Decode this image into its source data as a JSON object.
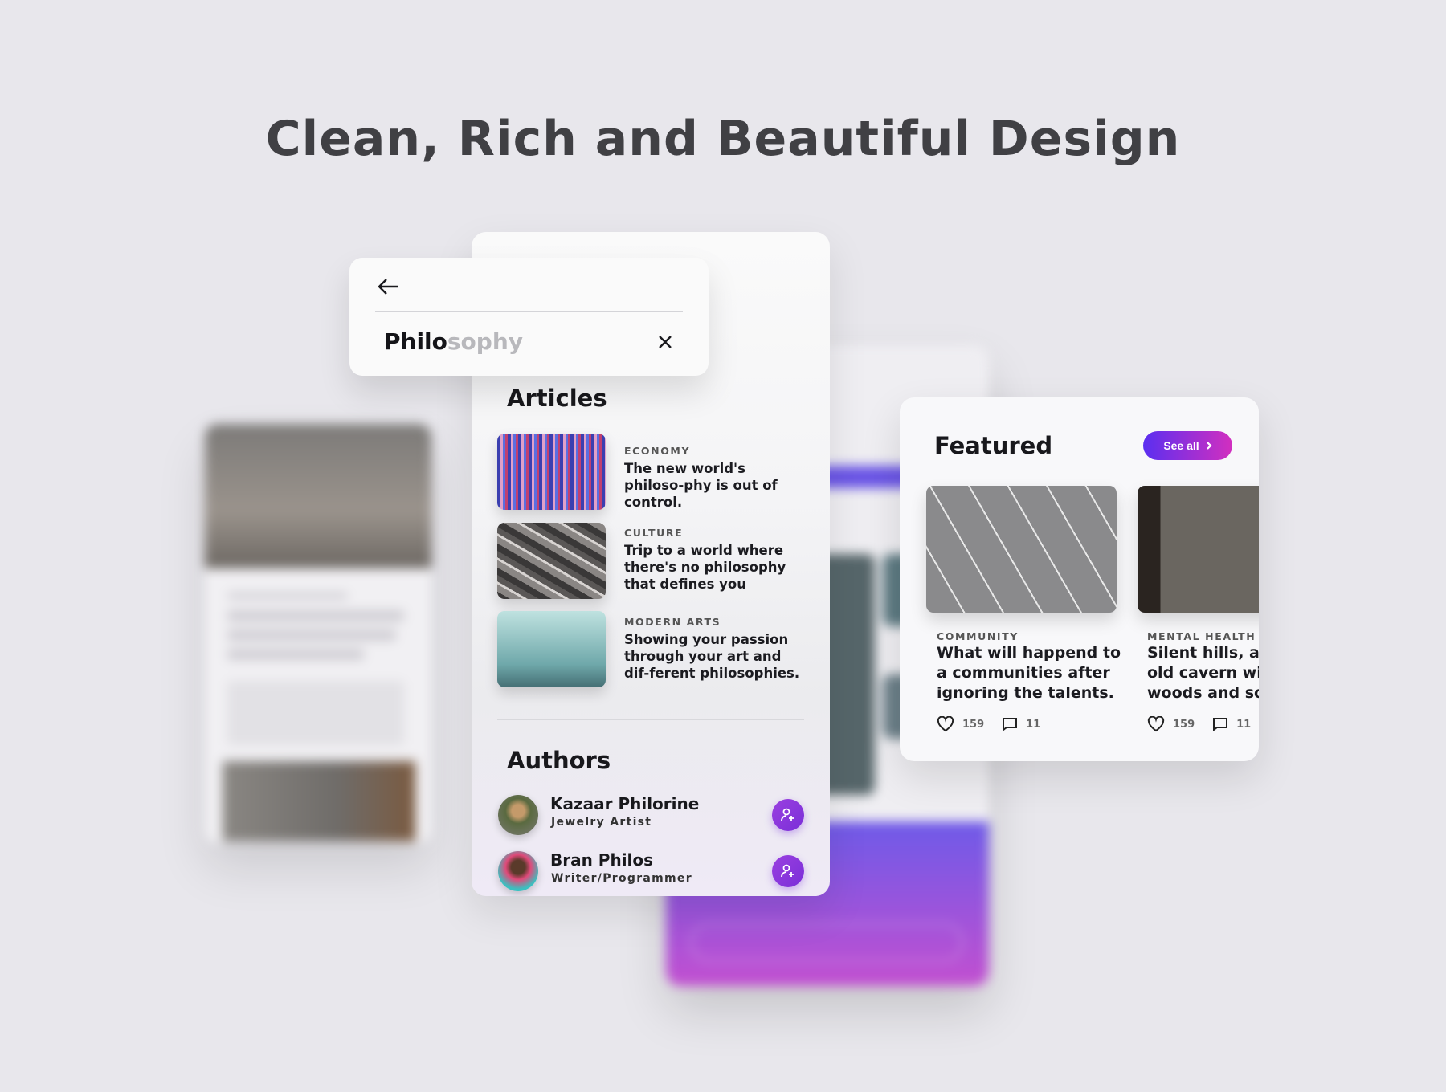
{
  "headline": "Clean, Rich and Beautiful Design",
  "colors": {
    "accent_start": "#5b2ff0",
    "accent_end": "#d22fbf",
    "add_button": "#8a36dc",
    "background": "#e8e7ec"
  },
  "search": {
    "typed": "Philo",
    "suggestion": "sophy",
    "back_icon": "arrow-left-icon",
    "clear_icon": "close-icon"
  },
  "articles": {
    "heading": "Articles",
    "items": [
      {
        "category": "Economy",
        "title": "The new world's philoso-phy is out of control."
      },
      {
        "category": "Culture",
        "title": "Trip to a world where there's no philosophy that defines you"
      },
      {
        "category": "Modern Arts",
        "title": "Showing your passion through your art and dif-ferent philosophies."
      }
    ]
  },
  "authors": {
    "heading": "Authors",
    "items": [
      {
        "name": "Kazaar Philorine",
        "role": "Jewelry Artist"
      },
      {
        "name": "Bran Philos",
        "role": "Writer/Programmer"
      }
    ]
  },
  "featured": {
    "heading": "Featured",
    "see_all": "See all",
    "items": [
      {
        "category": "COMMUNITY",
        "title_lines": [
          "What will happend to",
          "a communities after",
          "ignoring the talents."
        ],
        "likes": "159",
        "comments": "11"
      },
      {
        "category": "MENTAL HEALTH",
        "title_lines": [
          "Silent hills, and",
          "old cavern with",
          "woods and som"
        ],
        "likes": "159",
        "comments": "11"
      }
    ]
  }
}
